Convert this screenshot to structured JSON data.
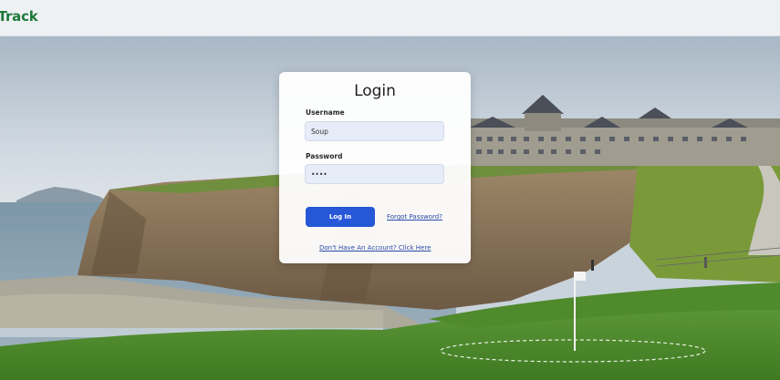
{
  "app": {
    "brand_title": "yTrack",
    "brand_color": "#1f7a3a"
  },
  "login": {
    "title": "Login",
    "username_label": "Username",
    "username_value": "Soup",
    "password_label": "Password",
    "password_value": "soup",
    "login_button": "Log In",
    "forgot_link": "Forgot Password?",
    "signup_link": "Don't Have An Account? Click Here"
  },
  "colors": {
    "accent": "#2557d6",
    "link": "#2b4aa8"
  }
}
